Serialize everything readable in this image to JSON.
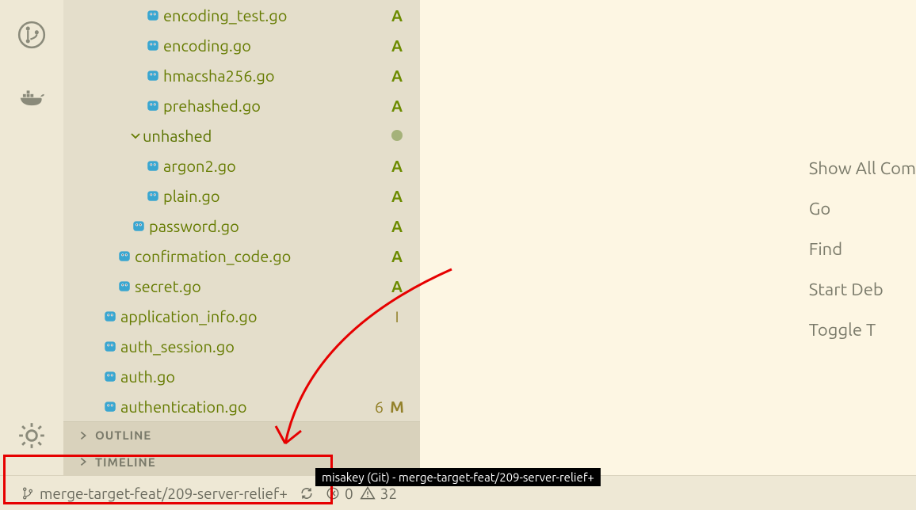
{
  "activity": {
    "items": [
      "source-control",
      "docker",
      "settings"
    ]
  },
  "tree": {
    "rows": [
      {
        "indent": 100,
        "icon": "go",
        "label": "encoding_test.go",
        "status": "A"
      },
      {
        "indent": 100,
        "icon": "go",
        "label": "encoding.go",
        "status": "A"
      },
      {
        "indent": 100,
        "icon": "go",
        "label": "hmacsha256.go",
        "status": "A"
      },
      {
        "indent": 100,
        "icon": "go",
        "label": "prehashed.go",
        "status": "A"
      },
      {
        "indent": 82,
        "icon": "chevron",
        "label": "unhashed",
        "folder": true,
        "dot": true
      },
      {
        "indent": 100,
        "icon": "go",
        "label": "argon2.go",
        "status": "A"
      },
      {
        "indent": 100,
        "icon": "go",
        "label": "plain.go",
        "status": "A"
      },
      {
        "indent": 82,
        "icon": "go",
        "label": "password.go",
        "status": "A"
      },
      {
        "indent": 64,
        "icon": "go",
        "label": "confirmation_code.go",
        "status": "A"
      },
      {
        "indent": 64,
        "icon": "go",
        "label": "secret.go",
        "status": "A"
      },
      {
        "indent": 46,
        "icon": "go",
        "label": "application_info.go",
        "status": "I"
      },
      {
        "indent": 46,
        "icon": "go",
        "label": "auth_session.go"
      },
      {
        "indent": 46,
        "icon": "go",
        "label": "auth.go"
      },
      {
        "indent": 46,
        "icon": "go",
        "label": "authentication.go",
        "count": "6",
        "status": "M"
      }
    ]
  },
  "sections": {
    "outline": "OUTLINE",
    "timeline": "TIMELINE"
  },
  "welcome": {
    "items": [
      "Show All Com",
      "Go",
      "Find",
      "Start Deb",
      "Toggle T"
    ]
  },
  "status": {
    "branch": "merge-target-feat/209-server-relief+",
    "sync_icon": "sync",
    "errors": "0",
    "warnings": "32"
  },
  "tooltip": "misakey (Git) - merge-target-feat/209-server-relief+"
}
